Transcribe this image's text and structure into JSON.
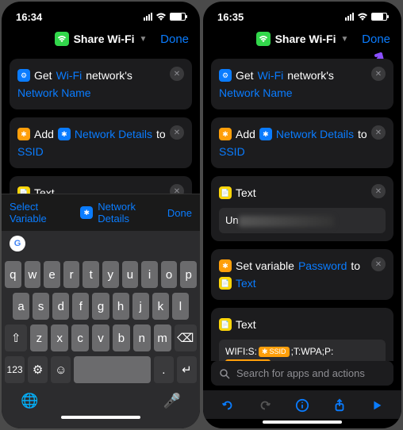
{
  "status": {
    "time": "16:34",
    "time_right": "16:35"
  },
  "nav": {
    "title": "Share Wi-Fi",
    "done": "Done"
  },
  "cards": {
    "get": {
      "verb": "Get",
      "wifi": "Wi-Fi",
      "tail": "network's",
      "prop": "Network Name"
    },
    "add": {
      "verb": "Add",
      "var": "Network Details",
      "to": "to",
      "target": "SSID"
    },
    "text1": {
      "title": "Text",
      "prefix": "Un"
    },
    "setvar": {
      "verb": "Set variable",
      "name": "Password",
      "to": "to",
      "target": "Text"
    },
    "text2": {
      "title": "Text",
      "p1": "WIFI:S:",
      "token_ssid": "SSID",
      "p2": ";T:WPA;P:",
      "token_pw": "Password",
      "p3": ";;"
    }
  },
  "kb_accessory": {
    "select": "Select Variable",
    "var": "Network Details",
    "done": "Done"
  },
  "keyboard": {
    "r1": [
      "q",
      "w",
      "e",
      "r",
      "t",
      "y",
      "u",
      "i",
      "o",
      "p"
    ],
    "r2": [
      "a",
      "s",
      "d",
      "f",
      "g",
      "h",
      "j",
      "k",
      "l"
    ],
    "r3": [
      "z",
      "x",
      "c",
      "v",
      "b",
      "n",
      "m"
    ],
    "num": "123",
    "space": "space",
    "ret": "return"
  },
  "search": {
    "placeholder": "Search for apps and actions"
  }
}
